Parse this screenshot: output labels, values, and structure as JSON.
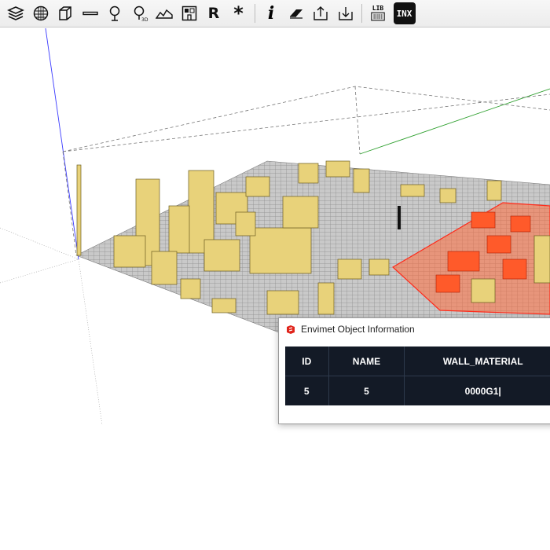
{
  "toolbar": {
    "icons": [
      "layers-icon",
      "grid-sphere-icon",
      "box-icon",
      "wall-icon",
      "tree-icon",
      "tree-3d-icon",
      "terrain-icon",
      "building-floorplan-icon",
      "receptor-icon",
      "source-icon",
      "info-icon",
      "eraser-icon",
      "export-icon",
      "import-icon",
      "library-icon",
      "inx-icon"
    ],
    "receptor_label": "R",
    "source_label": "*",
    "info_label": "i",
    "tree3d_label": "3D",
    "library_label": "LIB",
    "inx_label": "INX"
  },
  "dialog": {
    "title": "Envimet Object Information",
    "columns": [
      "ID",
      "NAME",
      "WALL_MATERIAL"
    ],
    "row": [
      "5",
      "5",
      "0000G1|"
    ]
  },
  "colors": {
    "building": "#e8d27a",
    "building_shade": "#b8a14a",
    "selected": "#ff3a1a",
    "table_bg": "#131a26",
    "axis_green": "#2fa02f",
    "axis_blue": "#3a3aff"
  }
}
